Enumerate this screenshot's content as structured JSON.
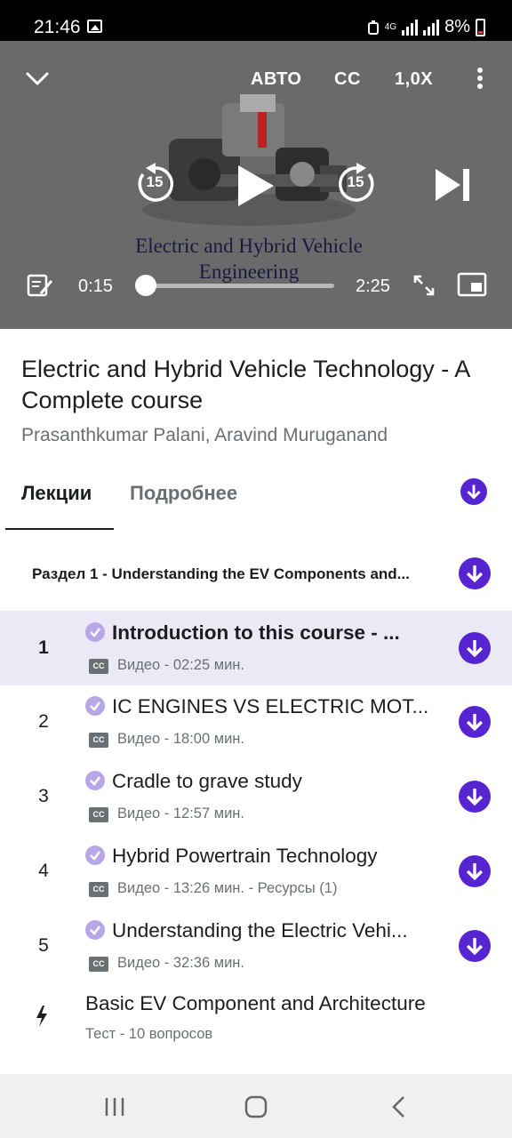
{
  "status_bar": {
    "time": "21:46",
    "network": "4G",
    "battery": "8%"
  },
  "player": {
    "speed_auto": "АВТО",
    "cc": "CC",
    "rate": "1,0X",
    "rewind_seconds": "15",
    "forward_seconds": "15",
    "elapsed": "0:15",
    "duration": "2:25",
    "progress_fraction": 0.1,
    "video_title_line1": "Electric and Hybrid Vehicle",
    "video_title_line2": "Engineering"
  },
  "course": {
    "title": "Electric and Hybrid Vehicle Technology - A Complete course",
    "authors": "Prasanthkumar Palani, Aravind Muruganand"
  },
  "tabs": {
    "lectures": "Лекции",
    "details": "Подробнее"
  },
  "section": {
    "title": "Раздел 1 - Understanding the EV Components and..."
  },
  "lectures": [
    {
      "num": "1",
      "title": "Introduction to this course - ...",
      "meta": "Видео - 02:25 мин.",
      "cc": "CC"
    },
    {
      "num": "2",
      "title": "IC ENGINES VS ELECTRIC MOT...",
      "meta": "Видео - 18:00 мин.",
      "cc": "CC"
    },
    {
      "num": "3",
      "title": "Cradle to grave study",
      "meta": "Видео - 12:57 мин.",
      "cc": "CC"
    },
    {
      "num": "4",
      "title": "Hybrid Powertrain Technology",
      "meta": "Видео - 13:26 мин. - Ресурсы (1)",
      "cc": "CC"
    },
    {
      "num": "5",
      "title": "Understanding the Electric Vehi...",
      "meta": "Видео - 32:36 мин.",
      "cc": "CC"
    }
  ],
  "quiz": {
    "title": "Basic EV Component and Architecture",
    "meta": "Тест - 10 вопросов"
  },
  "colors": {
    "accent": "#5624d0",
    "check": "#b7a7e6",
    "active_row": "#ece9f6"
  }
}
